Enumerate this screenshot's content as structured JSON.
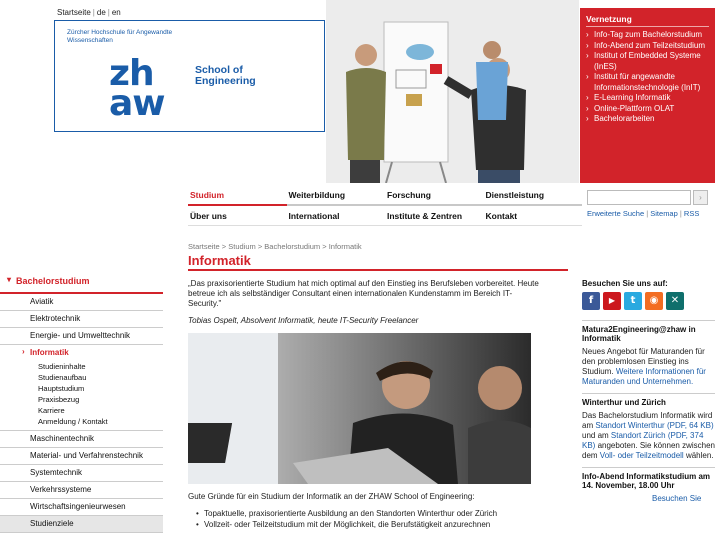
{
  "top_links": {
    "home": "Startseite",
    "sep": "|",
    "de": "de",
    "en": "en"
  },
  "logo": {
    "institution": "Zürcher Hochschule für Angewandte Wissenschaften",
    "mark_line1": "zh",
    "mark_line2": "aw",
    "school": "School of Engineering"
  },
  "vernetzung": {
    "title": "Vernetzung",
    "items": [
      "Info-Tag zum Bachelorstudium",
      "Info-Abend zum Teilzeitstudium",
      "Institut of Embedded Systeme (InES)",
      "Institut für angewandte Informationstechnologie (InIT)",
      "E-Learning Informatik",
      "Online-Plattform OLAT",
      "Bachelorarbeiten"
    ]
  },
  "nav": {
    "row1": [
      "Studium",
      "Weiterbildung",
      "Forschung",
      "Dienstleistung"
    ],
    "row2": [
      "Über uns",
      "International",
      "Institute & Zentren",
      "Kontakt"
    ]
  },
  "search": {
    "value": "",
    "button": "›",
    "advanced": "Erweiterte Suche",
    "sitemap": "Sitemap",
    "rss": "RSS",
    "sep": "|"
  },
  "sidebar": {
    "head": "Bachelorstudium",
    "items_before": [
      "Aviatik",
      "Elektrotechnik",
      "Energie- und Umwelttechnik"
    ],
    "active": "Informatik",
    "sub": [
      "Studieninhalte",
      "Studienaufbau",
      "Hauptstudium",
      "Praxisbezug",
      "Karriere",
      "Anmeldung / Kontakt"
    ],
    "items_after": [
      "Maschinentechnik",
      "Material- und Verfahrenstechnik",
      "Systemtechnik",
      "Verkehrssysteme",
      "Wirtschaftsingenieurwesen"
    ],
    "last": "Studienziele"
  },
  "content": {
    "breadcrumb": "Startseite > Studium > Bachelorstudium > Informatik",
    "title": "Informatik",
    "quote": "„Das praxisorientierte Studium hat mich optimal auf den Einstieg ins Berufsleben vorbereitet. Heute betreue ich als selbständiger Consultant einen internationalen Kundenstamm im Bereich IT-Security.\"",
    "quote_author": "Tobias Ospelt, Absolvent Informatik, heute IT-Security Freelancer",
    "reasons_intro": "Gute Gründe für ein Studium der Informatik an der ZHAW School of Engineering:",
    "bullets": [
      "Topaktuelle, praxisorientierte Ausbildung an den Standorten Winterthur oder Zürich",
      "Vollzeit- oder Teilzeitstudium mit der Möglichkeit, die Berufstätigkeit anzurechnen"
    ]
  },
  "right": {
    "social_title": "Besuchen Sie uns auf:",
    "social": [
      {
        "icon": "facebook-icon",
        "glyph": "f",
        "color": "#3b5998"
      },
      {
        "icon": "youtube-icon",
        "glyph": "▶",
        "color": "#cc181e"
      },
      {
        "icon": "twitter-icon",
        "glyph": "t",
        "color": "#2aa9e0"
      },
      {
        "icon": "issuu-icon",
        "glyph": "◉",
        "color": "#f36d21"
      },
      {
        "icon": "xing-icon",
        "glyph": "✕",
        "color": "#0f6f6c"
      }
    ],
    "block1_title": "Matura2Engineering@zhaw in Informatik",
    "block1_text": "Neues Angebot für Maturanden für den problemlosen Einstieg ins Studium.",
    "block1_link": "Weitere Informationen für Maturanden und Unternehmen.",
    "block2_title": "Winterthur und Zürich",
    "block2_text1": "Das Bachelorstudium Informatik wird am",
    "block2_link1": "Standort Winterthur (PDF, 64 KB)",
    "block2_text2": "und am",
    "block2_link2": "Standort Zürich (PDF, 374 KB)",
    "block2_text3": "angeboten. Sie können zwischen dem",
    "block2_link3": "Voll- oder Teilzeitmodell",
    "block2_text4": "wählen.",
    "block3_title": "Info-Abend Informatikstudium am 14. November, 18.00 Uhr",
    "block3_link": "Besuchen Sie"
  },
  "colors": {
    "accent": "#d2232a",
    "brand": "#1a5ca8"
  }
}
